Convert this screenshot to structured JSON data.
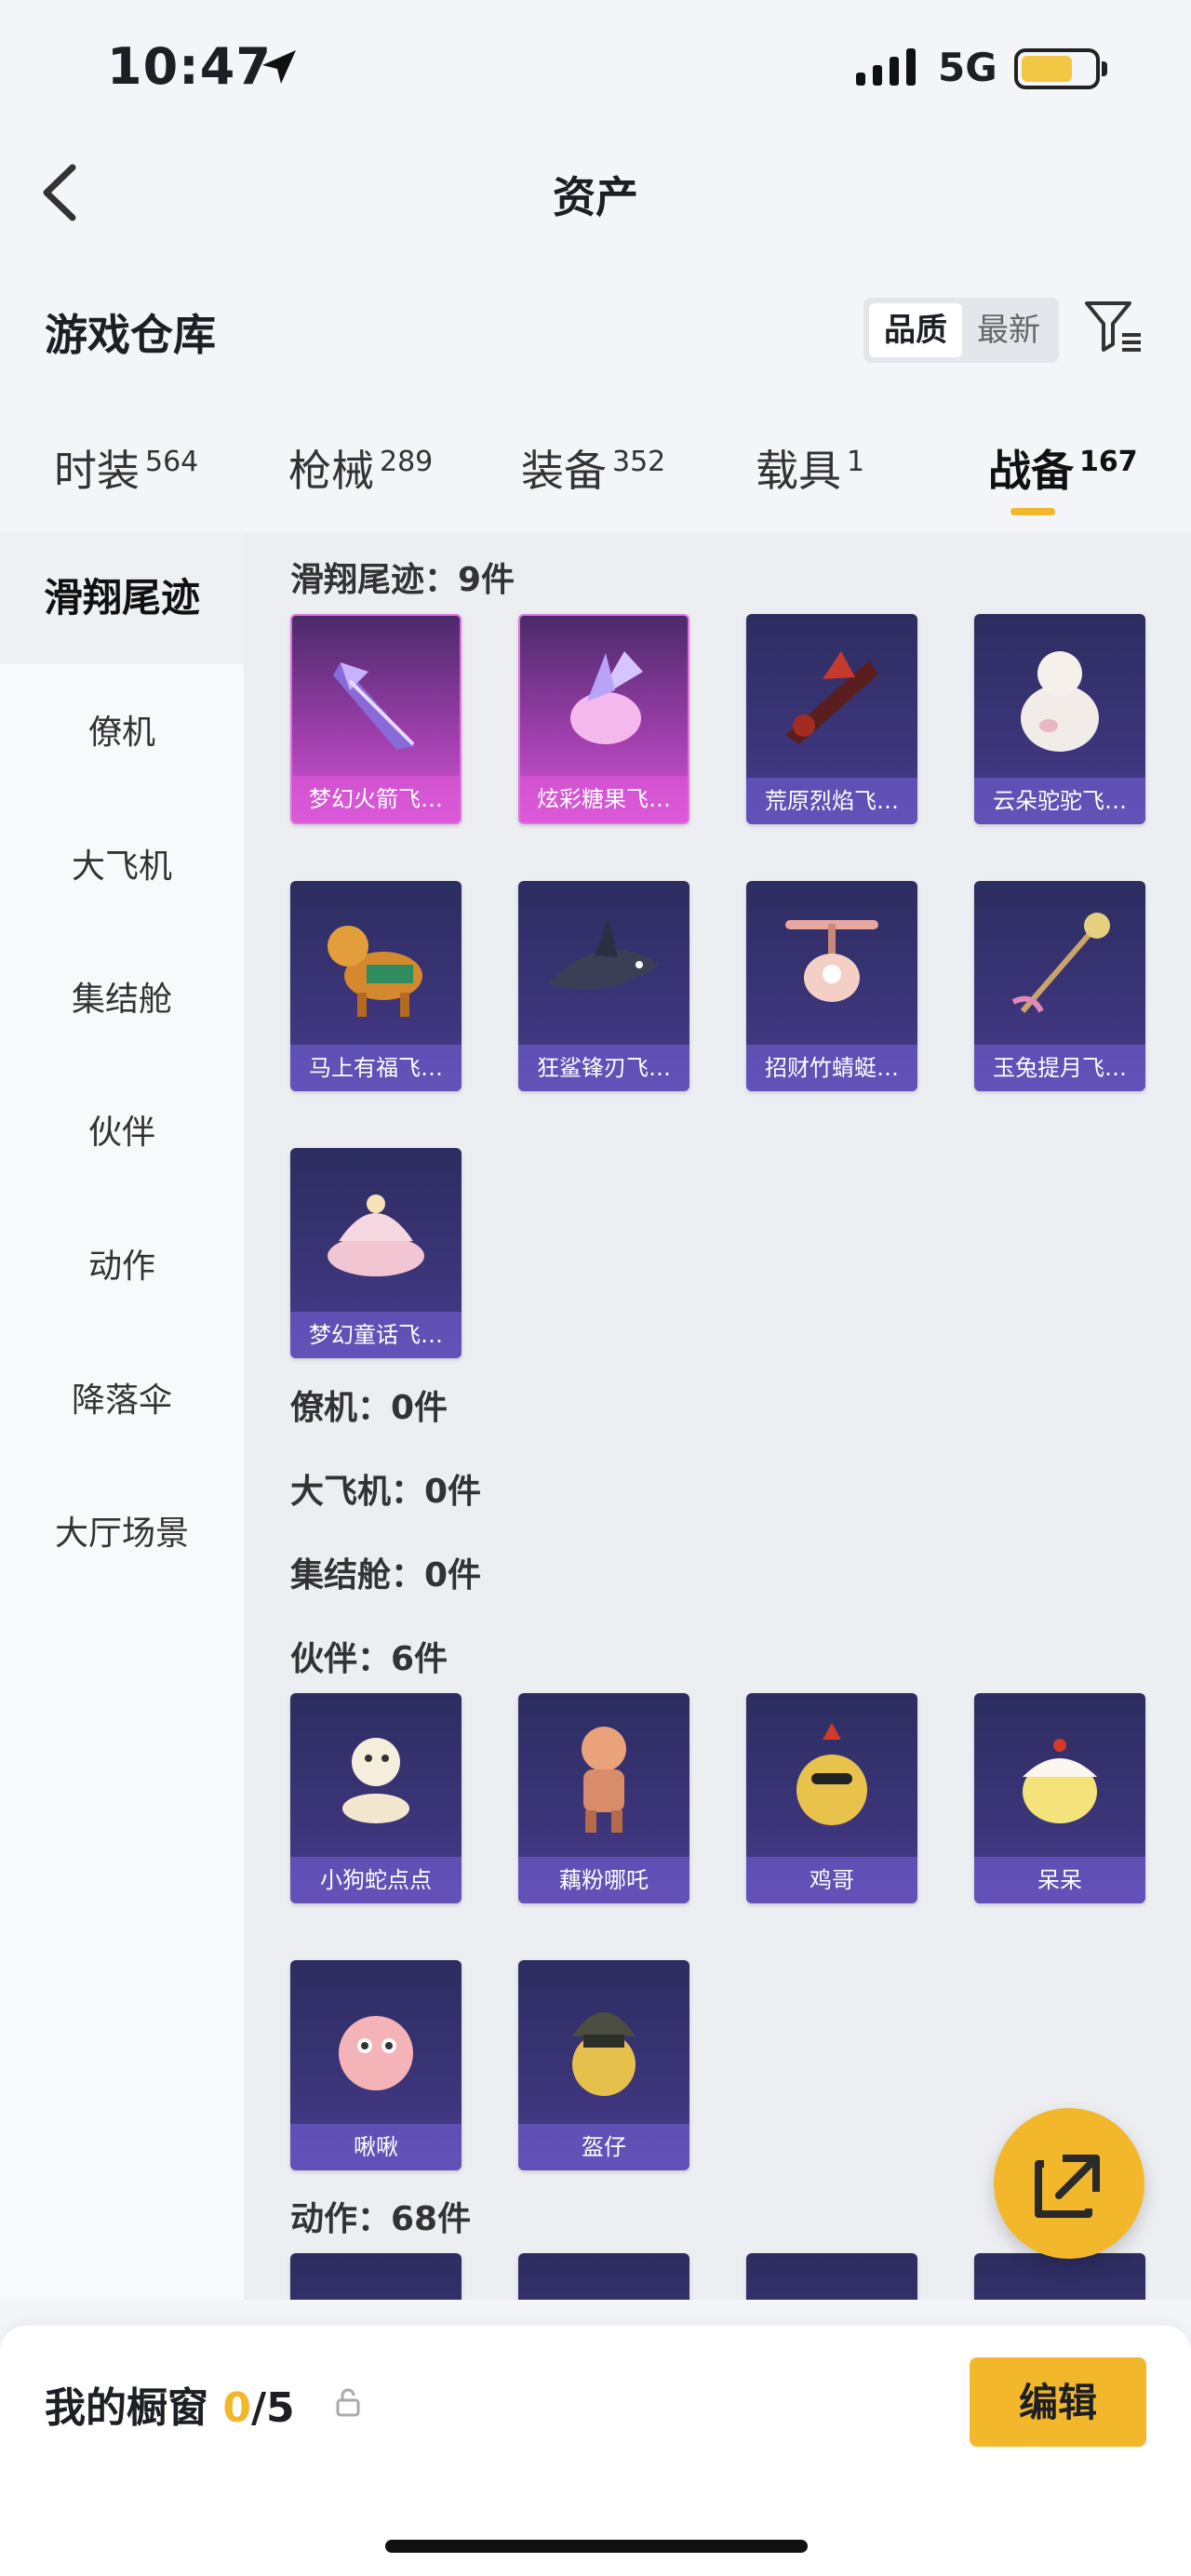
{
  "status": {
    "time": "10:47",
    "network": "5G"
  },
  "nav": {
    "title": "资产"
  },
  "header": {
    "title": "游戏仓库",
    "sort_quality": "品质",
    "sort_newest": "最新"
  },
  "tabs": [
    {
      "label": "时装",
      "count": "564"
    },
    {
      "label": "枪械",
      "count": "289"
    },
    {
      "label": "装备",
      "count": "352"
    },
    {
      "label": "载具",
      "count": "1"
    },
    {
      "label": "战备",
      "count": "167"
    }
  ],
  "sidebar": [
    "滑翔尾迹",
    "僚机",
    "大飞机",
    "集结舱",
    "伙伴",
    "动作",
    "降落伞",
    "大厅场景"
  ],
  "categories": {
    "glide": "滑翔尾迹：9件",
    "wingman": "僚机：0件",
    "plane": "大飞机：0件",
    "pod": "集结舱：0件",
    "partner": "伙伴：6件",
    "action": "动作：68件"
  },
  "glide_items": [
    "梦幻火箭飞…",
    "炫彩糖果飞…",
    "荒原烈焰飞…",
    "云朵驼驼飞…",
    "马上有福飞…",
    "狂鲨锋刃飞…",
    "招财竹蜻蜓…",
    "玉兔提月飞…",
    "梦幻童话飞…"
  ],
  "partner_items": [
    "小狗蛇点点",
    "藕粉哪吒",
    "鸡哥",
    "呆呆",
    "啾啾",
    "盔仔"
  ],
  "window": {
    "label": "我的橱窗",
    "current": "0",
    "total": "/5"
  },
  "edit_label": "编辑",
  "colors": {
    "accent": "#f2b72b",
    "card_blue": "#3a3477",
    "card_purple": "#a13fae"
  }
}
